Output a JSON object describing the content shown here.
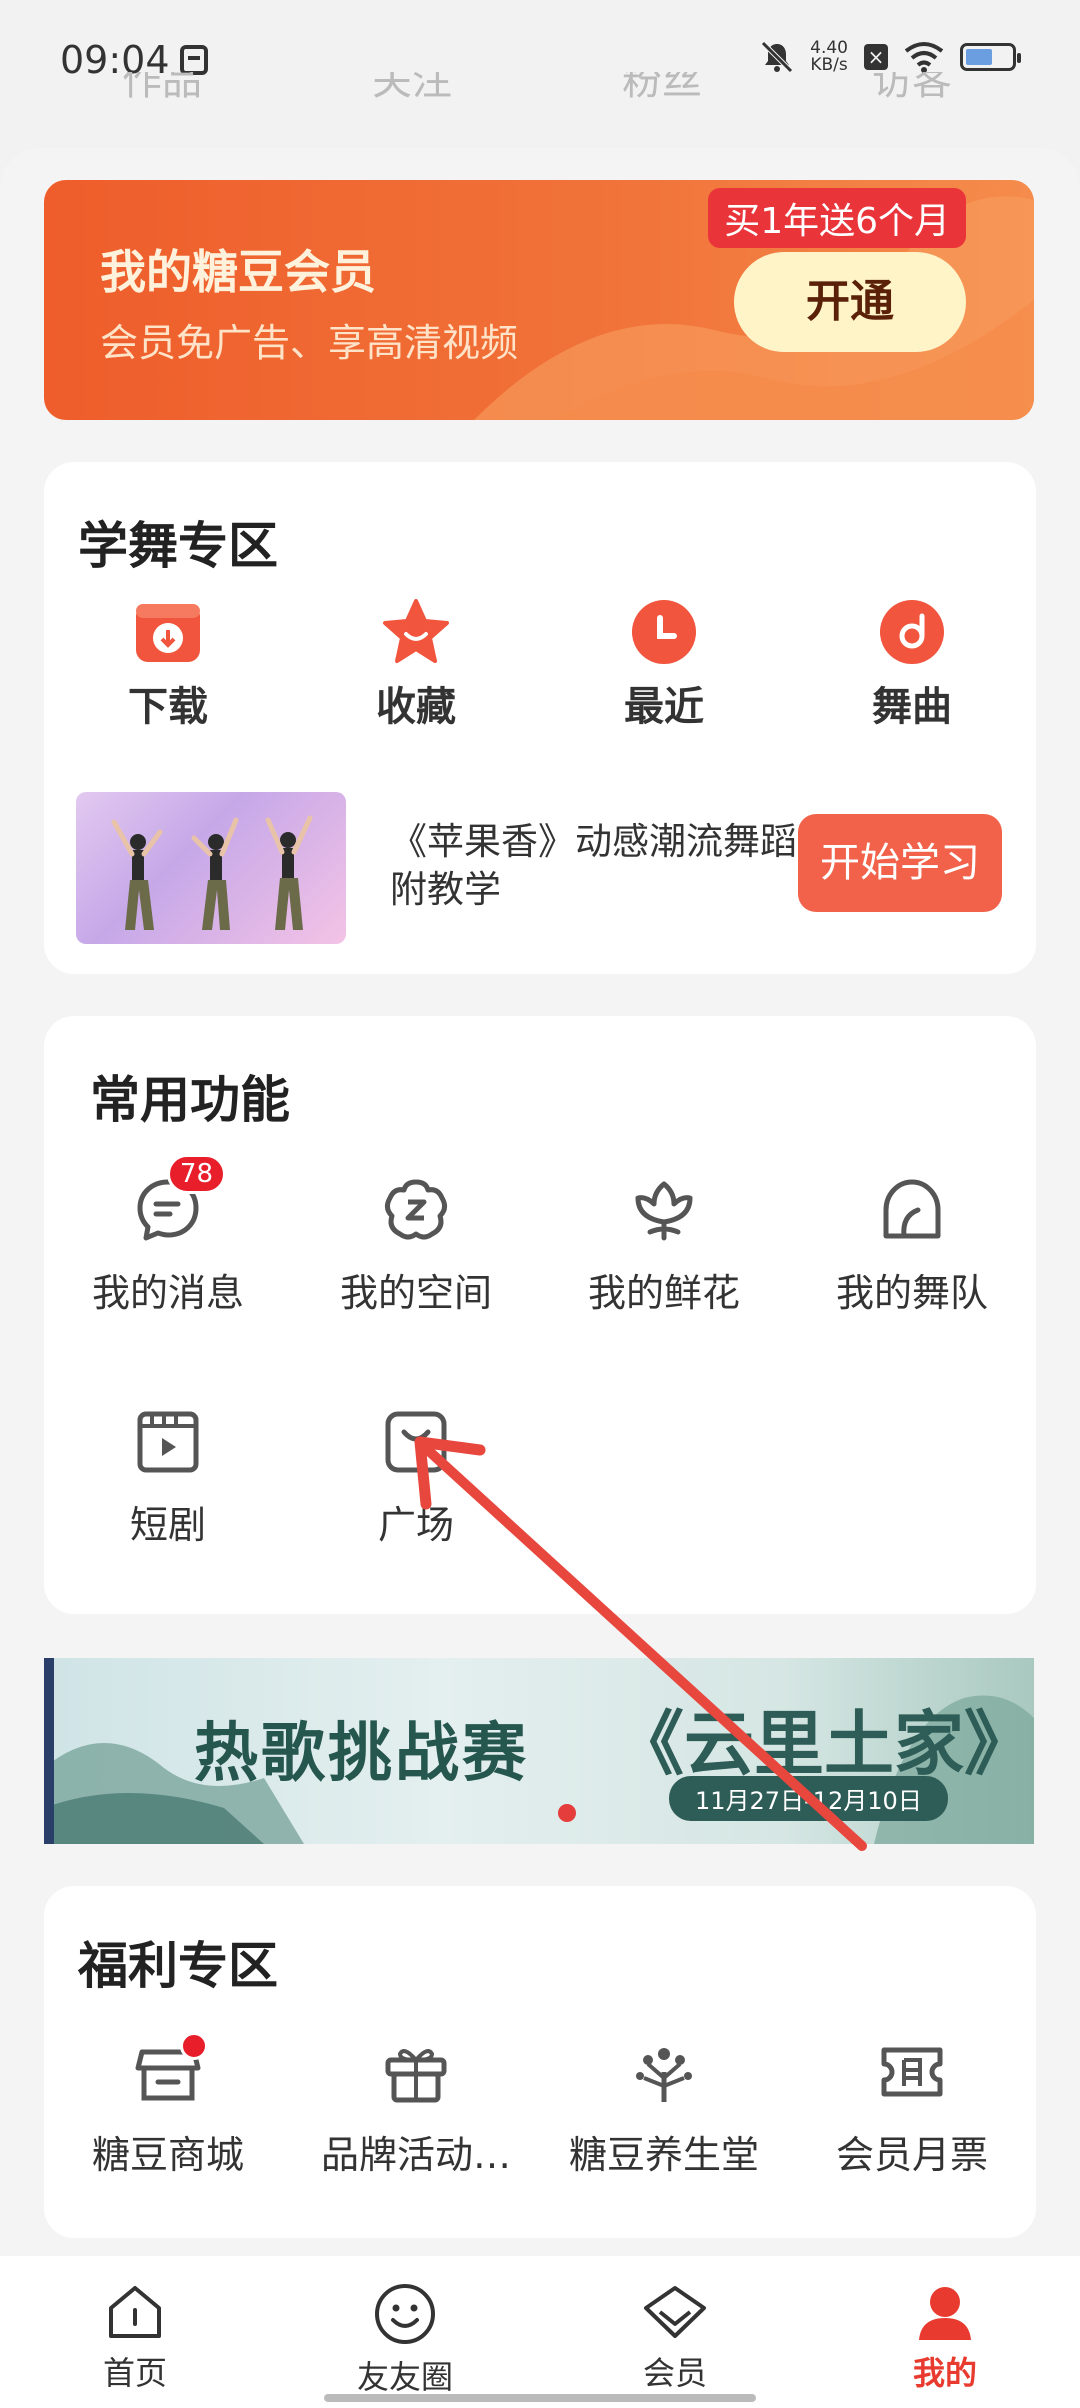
{
  "status_bar": {
    "time": "09:04",
    "speed_value": "4.40",
    "speed_unit": "KB/s"
  },
  "top_tabs_peek": [
    "作品",
    "关注",
    "粉丝",
    "访客"
  ],
  "vip_banner": {
    "title": "我的糖豆会员",
    "subtitle": "会员免广告、享高清视频",
    "promo_tag": "买1年送6个月",
    "button_label": "开通"
  },
  "dance_zone": {
    "title": "学舞专区",
    "items": [
      {
        "label": "下载",
        "icon": "download-icon"
      },
      {
        "label": "收藏",
        "icon": "star-icon"
      },
      {
        "label": "最近",
        "icon": "clock-icon"
      },
      {
        "label": "舞曲",
        "icon": "music-disc-icon"
      }
    ],
    "lesson": {
      "title": "《苹果香》动感潮流舞蹈附教学",
      "button_label": "开始学习"
    }
  },
  "common_functions": {
    "title": "常用功能",
    "items": [
      {
        "label": "我的消息",
        "icon": "message-icon",
        "badge": "78"
      },
      {
        "label": "我的空间",
        "icon": "space-icon"
      },
      {
        "label": "我的鲜花",
        "icon": "flower-icon"
      },
      {
        "label": "我的舞队",
        "icon": "team-icon"
      },
      {
        "label": "短剧",
        "icon": "short-drama-icon"
      },
      {
        "label": "广场",
        "icon": "plaza-icon"
      }
    ]
  },
  "event_banner": {
    "title": "热歌挑战赛",
    "song": "《云里土家》",
    "dates": "11月27日-12月10日"
  },
  "welfare_zone": {
    "title": "福利专区",
    "items": [
      {
        "label": "糖豆商城",
        "icon": "shop-icon"
      },
      {
        "label": "品牌活动…",
        "icon": "gift-icon"
      },
      {
        "label": "糖豆养生堂",
        "icon": "tree-icon"
      },
      {
        "label": "会员月票",
        "icon": "ticket-icon"
      }
    ]
  },
  "tab_bar": {
    "items": [
      {
        "label": "首页",
        "icon": "home-icon"
      },
      {
        "label": "友友圈",
        "icon": "smile-icon"
      },
      {
        "label": "会员",
        "icon": "diamond-icon"
      },
      {
        "label": "我的",
        "icon": "user-icon"
      }
    ],
    "active_index": 3
  },
  "colors": {
    "accent": "#e83a2f",
    "vip_orange": "#ee5d2b",
    "lesson_button": "#f2624a"
  }
}
